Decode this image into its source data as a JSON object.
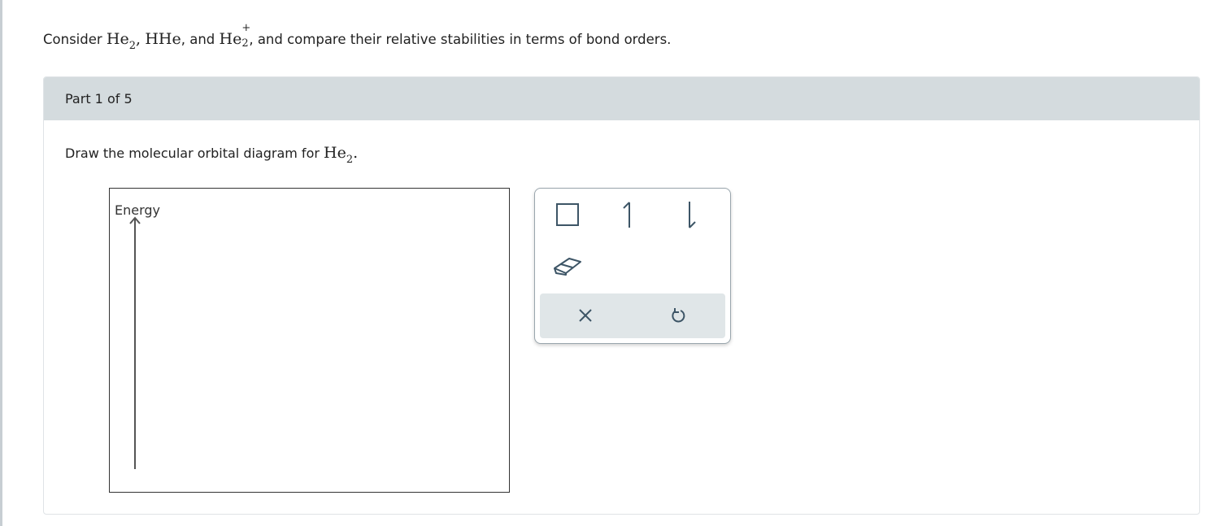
{
  "question": {
    "prefix": "Consider ",
    "species1_base": "He",
    "species1_sub": "2",
    "comma1": ",",
    "species2": "HHe",
    "and": ", and ",
    "species3_base": "He",
    "species3_sup": "+",
    "species3_sub": "2",
    "suffix": ", and compare their relative stabilities in terms of bond orders."
  },
  "part": {
    "title": "Part 1 of 5",
    "prompt_prefix": "Draw the molecular orbital diagram for ",
    "prompt_species_base": "He",
    "prompt_species_sub": "2",
    "prompt_suffix": "."
  },
  "diagram": {
    "axis_label": "Energy"
  },
  "toolbox": {
    "tools": [
      {
        "name": "orbital-box-tool",
        "icon": "square-icon"
      },
      {
        "name": "spin-up-tool",
        "icon": "half-arrow-up-icon"
      },
      {
        "name": "spin-down-tool",
        "icon": "half-arrow-down-icon"
      },
      {
        "name": "eraser-tool",
        "icon": "eraser-icon"
      }
    ],
    "actions": [
      {
        "name": "clear-button",
        "icon": "close-icon"
      },
      {
        "name": "undo-button",
        "icon": "undo-icon"
      }
    ]
  },
  "colors": {
    "header_bg": "#d4dbde",
    "icon": "#3d5566",
    "action_bg": "#e0e6e8"
  }
}
